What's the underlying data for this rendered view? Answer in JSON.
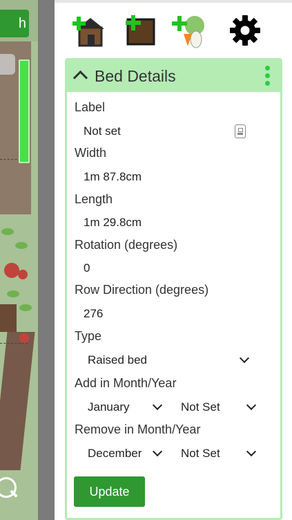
{
  "canvas": {
    "search_button_partial": "h"
  },
  "toolbar": {
    "add_building_icon": "add-building-icon",
    "add_bed_icon": "add-bed-icon",
    "add_plant_icon": "add-plant-icon",
    "settings_icon": "gear-icon"
  },
  "details": {
    "title": "Bed Details",
    "fields": {
      "label": {
        "label": "Label",
        "value": "Not set"
      },
      "width": {
        "label": "Width",
        "value": "1m 87.8cm"
      },
      "length": {
        "label": "Length",
        "value": "1m 29.8cm"
      },
      "rotation": {
        "label": "Rotation (degrees)",
        "value": "0"
      },
      "row_direction": {
        "label": "Row Direction (degrees)",
        "value": "276"
      },
      "type": {
        "label": "Type",
        "value": "Raised bed"
      },
      "add_in": {
        "label": "Add in Month/Year",
        "month": "January",
        "year": "Not Set"
      },
      "remove_in": {
        "label": "Remove in Month/Year",
        "month": "December",
        "year": "Not Set"
      }
    },
    "update_label": "Update"
  },
  "colors": {
    "accent_green": "#2f9830",
    "header_green": "#b4ecb4",
    "kebab_green": "#2ecc40"
  }
}
